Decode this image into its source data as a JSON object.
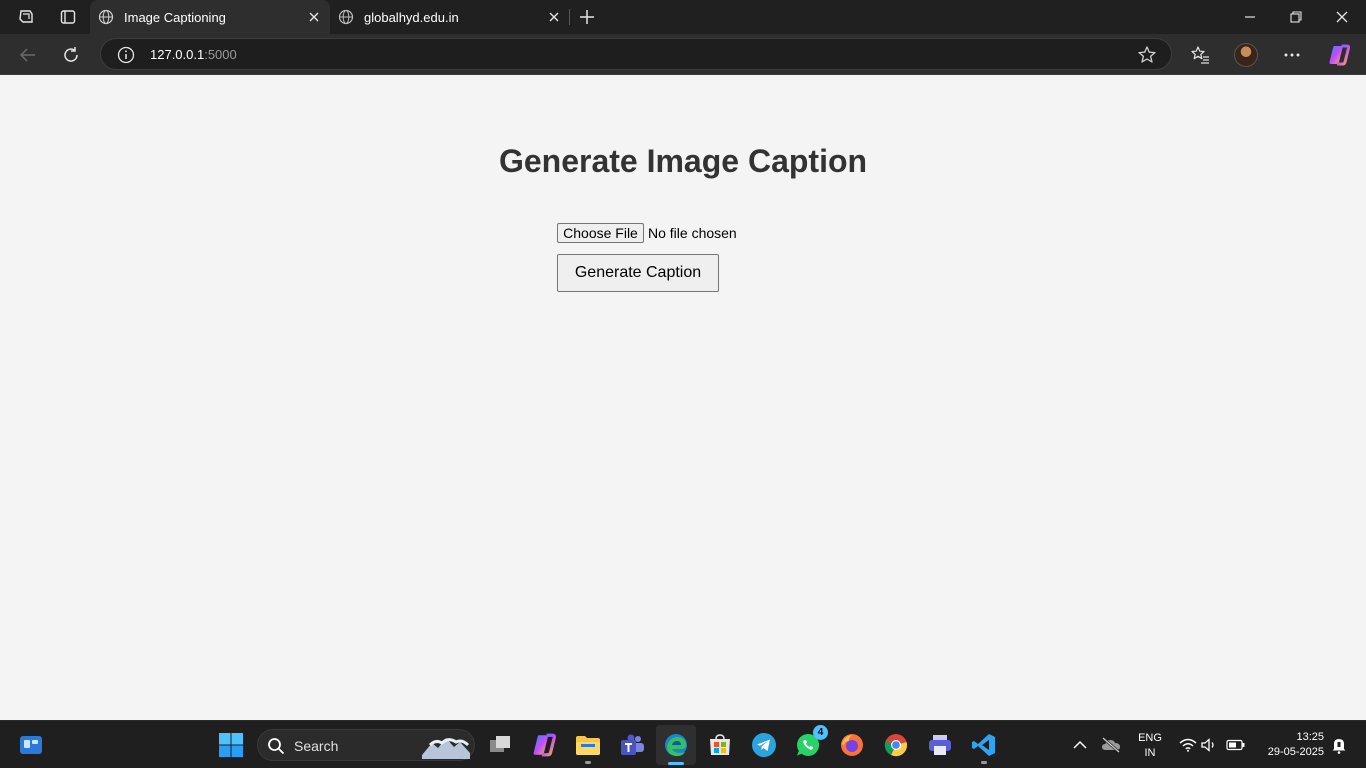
{
  "browser": {
    "tabs": [
      {
        "title": "Image Captioning",
        "active": true
      },
      {
        "title": "globalhyd.edu.in",
        "active": false
      }
    ],
    "address": {
      "host": "127.0.0.1",
      "port": ":5000"
    }
  },
  "page": {
    "title": "Generate Image Caption",
    "file_input": {
      "button_label": "Choose File",
      "status": "No file chosen"
    },
    "submit_label": "Generate Caption"
  },
  "taskbar": {
    "search_label": "Search",
    "whatsapp_badge": "4",
    "language": {
      "line1": "ENG",
      "line2": "IN"
    },
    "clock": {
      "time": "13:25",
      "date": "29-05-2025"
    }
  },
  "colors": {
    "page_background": "#f4f4f4",
    "title_color": "#333333",
    "browser_chrome": "#202020",
    "taskbar": "#1f1f1f",
    "accent": "#4cc2ff"
  }
}
